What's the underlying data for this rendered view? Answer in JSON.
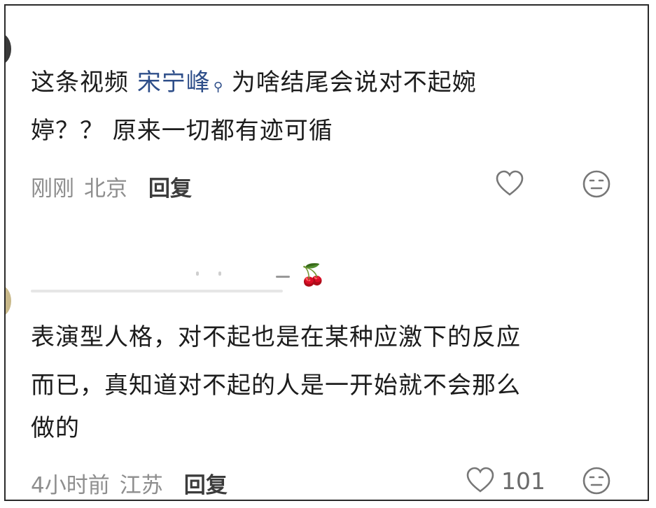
{
  "comments": [
    {
      "text_before": "这条视频 ",
      "mention": "宋宁峰",
      "text_after": " 为啥结尾会说对不起婉",
      "line2": "婷？？ 原来一切都有迹可循",
      "time": "刚刚",
      "location": "北京",
      "reply_label": "回复",
      "like_icon": "heart-outline",
      "dislike_icon": "neutral-face"
    },
    {
      "username_badge": "🍒",
      "line1": "表演型人格，对不起也是在某种应激下的反应",
      "line2": "而已，真知道对不起的人是一开始就不会那么",
      "line3": "做的",
      "time": "4小时前",
      "location": "江苏",
      "reply_label": "回复",
      "like_count": "101",
      "like_icon": "heart-outline",
      "dislike_icon": "neutral-face"
    }
  ]
}
